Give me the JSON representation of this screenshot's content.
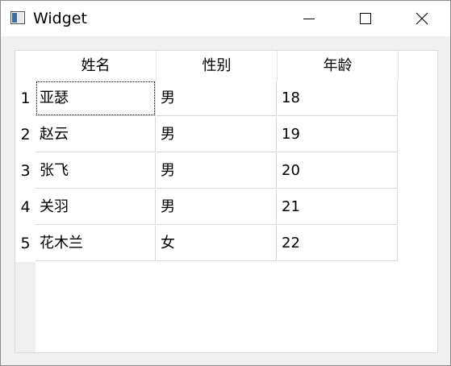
{
  "window": {
    "title": "Widget",
    "minimize_icon": "minimize-icon",
    "maximize_icon": "maximize-icon",
    "close_icon": "close-icon"
  },
  "table": {
    "headers": [
      "姓名",
      "性别",
      "年龄"
    ],
    "row_labels": [
      "1",
      "2",
      "3",
      "4",
      "5"
    ],
    "rows": [
      [
        "亚瑟",
        "男",
        "18"
      ],
      [
        "赵云",
        "男",
        "19"
      ],
      [
        "张飞",
        "男",
        "20"
      ],
      [
        "关羽",
        "男",
        "21"
      ],
      [
        "花木兰",
        "女",
        "22"
      ]
    ],
    "focused_cell": {
      "row": 0,
      "col": 0
    }
  }
}
